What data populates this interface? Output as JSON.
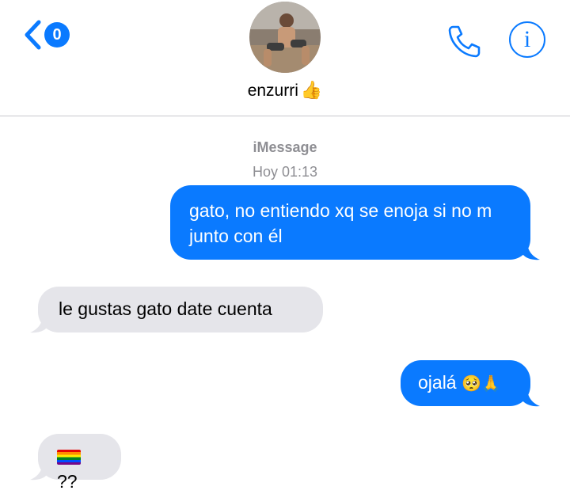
{
  "header": {
    "back_badge": "0",
    "contact_name": "enzurri",
    "contact_emoji": "👍",
    "icons": {
      "back": "chevron-left-icon",
      "call": "phone-icon",
      "info": "info-icon"
    }
  },
  "thread": {
    "service": "iMessage",
    "timestamp": "Hoy 01:13"
  },
  "messages": [
    {
      "from": "me",
      "text": "gato, no entiendo xq se enoja si no m junto con él"
    },
    {
      "from": "them",
      "text": "le gustas gato date cuenta"
    },
    {
      "from": "me",
      "text": "ojalá",
      "emoji": "🥺🙏"
    },
    {
      "from": "them",
      "text": "??",
      "emoji": "🏳️‍🌈"
    }
  ],
  "colors": {
    "sent_bubble": "#0a7aff",
    "received_bubble": "#e5e5ea",
    "meta_text": "#8e8e93"
  }
}
